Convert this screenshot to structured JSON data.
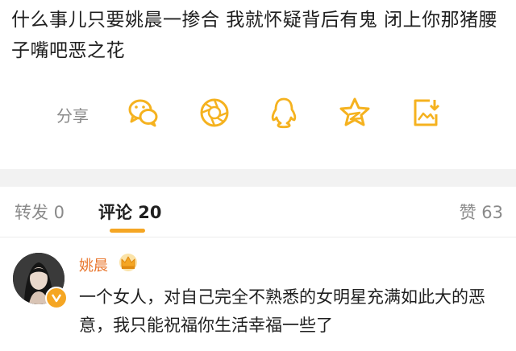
{
  "post": {
    "text": "什么事儿只要姚晨一掺合 我就怀疑背后有鬼 闭上你那猪腰子嘴吧恶之花"
  },
  "share": {
    "label": "分享",
    "icons": [
      "wechat-icon",
      "moments-icon",
      "qq-icon",
      "qzone-star-icon",
      "save-image-icon"
    ]
  },
  "tabs": {
    "repost": "转发 0",
    "comments": "评论 20",
    "likes": "赞 63"
  },
  "comment": {
    "user": "姚晨",
    "text": "一个女人，对自己完全不熟悉的女明星充满如此大的恶意，我只能祝福你生活幸福一些了"
  },
  "colors": {
    "accent": "#f5a623",
    "username": "#e8742a",
    "share_icons": "#f5b21f"
  }
}
